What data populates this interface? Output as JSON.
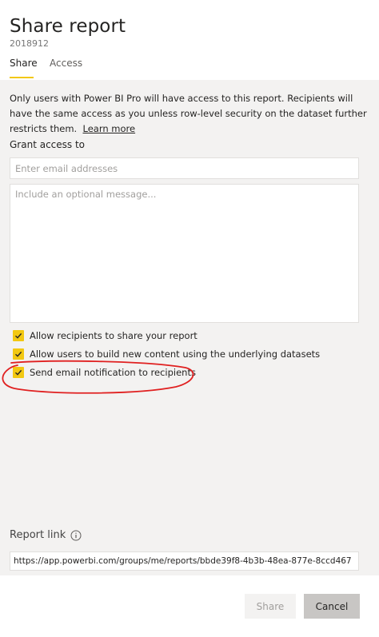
{
  "dialog": {
    "title": "Share report",
    "subtitle": "2018912"
  },
  "tabs": {
    "share": "Share",
    "access": "Access",
    "active": "share"
  },
  "info": {
    "text": "Only users with Power BI Pro will have access to this report. Recipients will have the same access as you unless row-level security on the dataset further restricts them.",
    "learn_more": "Learn more"
  },
  "grant": {
    "label": "Grant access to",
    "email_placeholder": "Enter email addresses",
    "message_placeholder": "Include an optional message..."
  },
  "options": [
    {
      "label": "Allow recipients to share your report",
      "checked": true
    },
    {
      "label": "Allow users to build new content using the underlying datasets",
      "checked": true
    },
    {
      "label": "Send email notification to recipients",
      "checked": true
    }
  ],
  "report_link": {
    "label": "Report link",
    "url": "https://app.powerbi.com/groups/me/reports/bbde39f8-4b3b-48ea-877e-8ccd467"
  },
  "buttons": {
    "share": "Share",
    "cancel": "Cancel"
  },
  "colors": {
    "accent": "#f2c811",
    "annotation": "#e02020"
  },
  "icons": {
    "check": "check-icon",
    "info": "info-icon"
  }
}
